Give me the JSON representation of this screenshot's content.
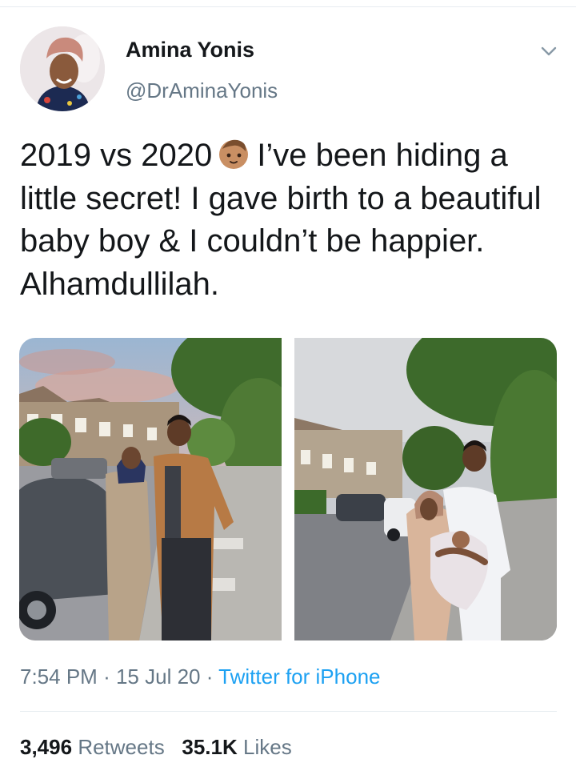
{
  "author": {
    "name": "Amina Yonis",
    "handle": "@DrAminaYonis",
    "avatar_icon": "profile-photo"
  },
  "tweet": {
    "text_before_emoji": "2019 vs 2020",
    "emoji": "baby-face-emoji",
    "text_after_emoji": "I’ve been hiding a little secret! I gave birth to a beautiful baby boy & I couldn’t be happier. Alhamdullilah."
  },
  "media": [
    {
      "alt_icon": "couple-street-photo-2019"
    },
    {
      "alt_icon": "couple-with-baby-photo-2020"
    }
  ],
  "meta": {
    "time": "7:54 PM",
    "separator": "·",
    "date": "15 Jul 20",
    "source": "Twitter for iPhone"
  },
  "stats": {
    "retweets_count": "3,496",
    "retweets_label": "Retweets",
    "likes_count": "35.1K",
    "likes_label": "Likes"
  },
  "colors": {
    "text": "#14171a",
    "secondary": "#657786",
    "link": "#1da1f2",
    "divider": "#e6ecf0"
  }
}
